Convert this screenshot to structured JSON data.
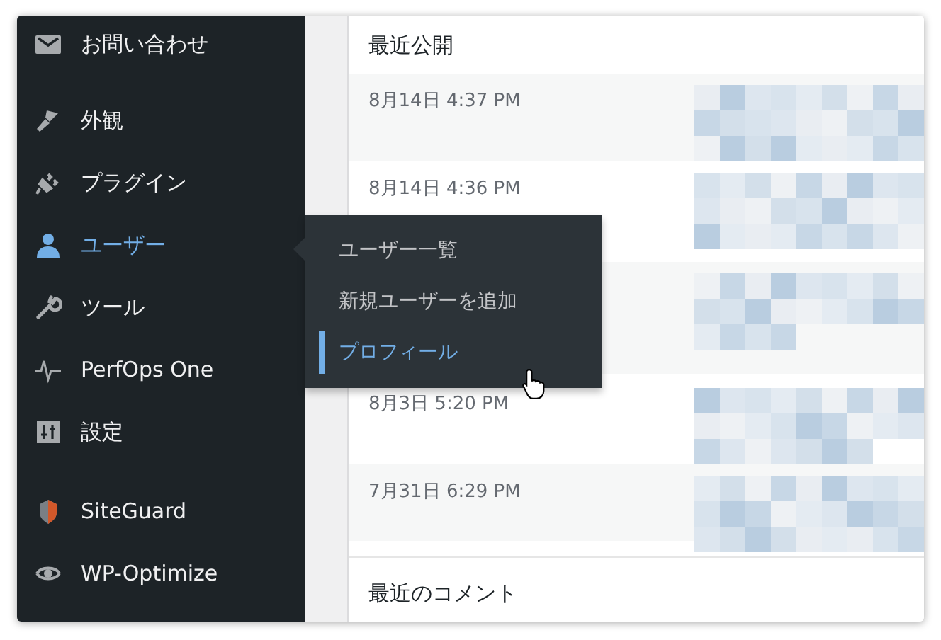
{
  "sidebar": {
    "groups": [
      [
        {
          "label": "お問い合わせ",
          "selected": false
        }
      ],
      [
        {
          "label": "外観",
          "selected": false
        },
        {
          "label": "プラグイン",
          "selected": false
        },
        {
          "label": "ユーザー",
          "selected": true
        },
        {
          "label": "ツール",
          "selected": false
        },
        {
          "label": "PerfOps One",
          "selected": false
        },
        {
          "label": "設定",
          "selected": false
        }
      ],
      [
        {
          "label": "SiteGuard",
          "selected": false
        },
        {
          "label": "WP-Optimize",
          "selected": false
        }
      ]
    ]
  },
  "submenu": {
    "items": [
      {
        "label": "ユーザー一覧",
        "selected": false
      },
      {
        "label": "新規ユーザーを追加",
        "selected": false
      },
      {
        "label": "プロフィール",
        "selected": true
      }
    ]
  },
  "recent_published": {
    "title": "最近公開",
    "rows": [
      {
        "date": "8月14日 4:37 PM"
      },
      {
        "date": "8月14日 4:36 PM"
      },
      {},
      {
        "date": "8月3日 5:20 PM"
      },
      {
        "date": "7月31日 6:29 PM"
      }
    ]
  },
  "recent_comments": {
    "title": "最近のコメント"
  }
}
